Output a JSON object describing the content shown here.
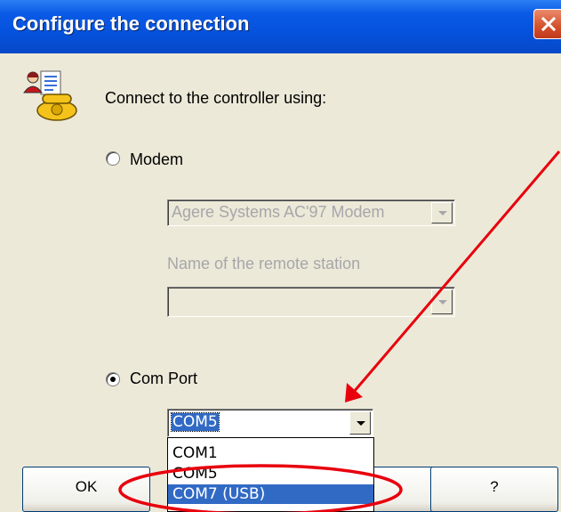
{
  "window": {
    "title": "Configure the connection"
  },
  "icons": {
    "app": "phone-contact-icon",
    "close": "close-icon",
    "dropdown_arrow": "chevron-down-icon"
  },
  "prompt": "Connect to the controller using:",
  "modem": {
    "label": "Modem",
    "selected": false,
    "device_value": "Agere Systems AC'97 Modem",
    "remote_station_label": "Name of the remote station",
    "remote_station_value": ""
  },
  "com_port": {
    "label": "Com Port",
    "selected": true,
    "value": "COM5",
    "options": [
      "COM1",
      "COM5",
      "COM7 (USB)"
    ],
    "highlighted_option": "COM7 (USB)"
  },
  "buttons": {
    "ok": "OK",
    "help": "?"
  },
  "colors": {
    "titlebar": "#0552dc",
    "close_button": "#d4502c",
    "selection": "#316ac5",
    "annotation": "#e8000d",
    "dialog_background": "#ece9d8"
  }
}
